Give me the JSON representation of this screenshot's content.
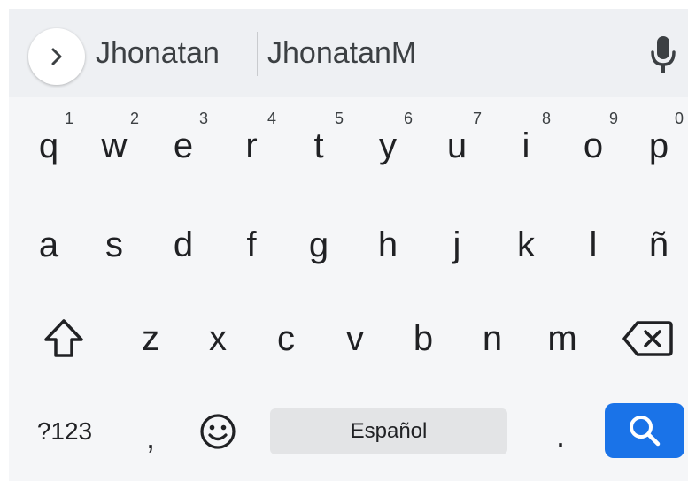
{
  "suggestion_bar": {
    "suggestions": [
      "Jhonatan",
      "JhonatanM"
    ]
  },
  "keyboard": {
    "row1": [
      {
        "key": "q",
        "hint": "1"
      },
      {
        "key": "w",
        "hint": "2"
      },
      {
        "key": "e",
        "hint": "3"
      },
      {
        "key": "r",
        "hint": "4"
      },
      {
        "key": "t",
        "hint": "5"
      },
      {
        "key": "y",
        "hint": "6"
      },
      {
        "key": "u",
        "hint": "7"
      },
      {
        "key": "i",
        "hint": "8"
      },
      {
        "key": "o",
        "hint": "9"
      },
      {
        "key": "p",
        "hint": "0"
      }
    ],
    "row2": [
      "a",
      "s",
      "d",
      "f",
      "g",
      "h",
      "j",
      "k",
      "l",
      "ñ"
    ],
    "row3": [
      "z",
      "x",
      "c",
      "v",
      "b",
      "n",
      "m"
    ],
    "bottom": {
      "symbols_label": "?123",
      "comma": ",",
      "space_label": "Español",
      "period": "."
    },
    "icons": {
      "expand": "chevron-right-icon",
      "mic": "microphone-icon",
      "shift": "shift-icon",
      "backspace": "backspace-icon",
      "emoji": "emoji-icon",
      "search": "search-icon"
    },
    "colors": {
      "background": "#f5f6f8",
      "suggestion_bar": "#eef0f3",
      "accent": "#1a73e8",
      "space_key": "#e3e4e6"
    }
  }
}
